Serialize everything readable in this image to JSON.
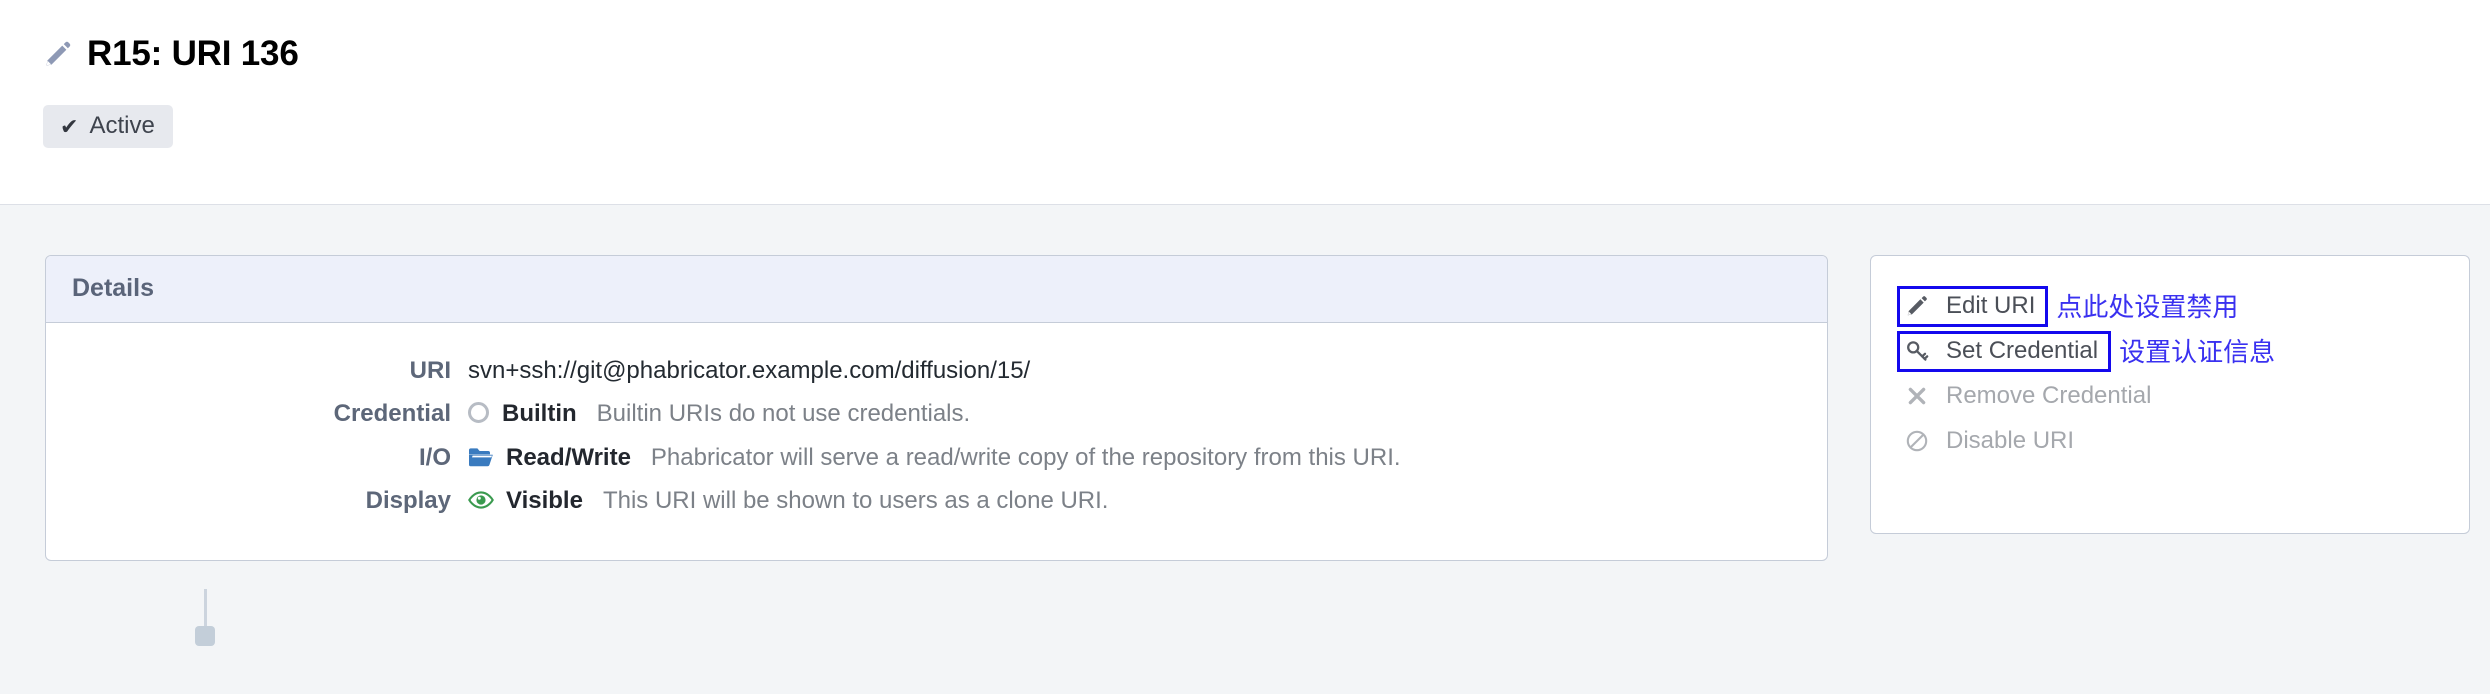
{
  "header": {
    "icon": "pencil-icon",
    "title": "R15: URI 136",
    "status": {
      "icon": "check-icon",
      "label": "Active"
    }
  },
  "details": {
    "panel_title": "Details",
    "rows": [
      {
        "label": "URI",
        "icon": "",
        "value": "svn+ssh://git@phabricator.example.com/diffusion/15/",
        "description": ""
      },
      {
        "label": "Credential",
        "icon": "circle-outline-icon",
        "value": "Builtin",
        "description": "Builtin URIs do not use credentials."
      },
      {
        "label": "I/O",
        "icon": "folder-open-icon",
        "value": "Read/Write",
        "description": "Phabricator will serve a read/write copy of the repository from this URI."
      },
      {
        "label": "Display",
        "icon": "eye-icon",
        "value": "Visible",
        "description": "This URI will be shown to users as a clone URI."
      }
    ]
  },
  "actions": {
    "items": [
      {
        "icon": "pencil-icon",
        "label": "Edit URI",
        "annotation": "点此处设置禁用",
        "highlighted": true,
        "disabled": false
      },
      {
        "icon": "key-icon",
        "label": "Set Credential",
        "annotation": "设置认证信息",
        "highlighted": true,
        "disabled": false
      },
      {
        "icon": "close-x-icon",
        "label": "Remove Credential",
        "annotation": "",
        "highlighted": false,
        "disabled": true
      },
      {
        "icon": "ban-icon",
        "label": "Disable URI",
        "annotation": "",
        "highlighted": false,
        "disabled": true
      }
    ]
  },
  "colors": {
    "annotation": "#3a31f0",
    "highlight_box": "#1409ed",
    "panel_header": "#edf0fa",
    "label": "#5d6779",
    "folder_blue": "#3a7bbf",
    "eye_green": "#3a9a4f",
    "page_bg": "#f3f5f7"
  }
}
